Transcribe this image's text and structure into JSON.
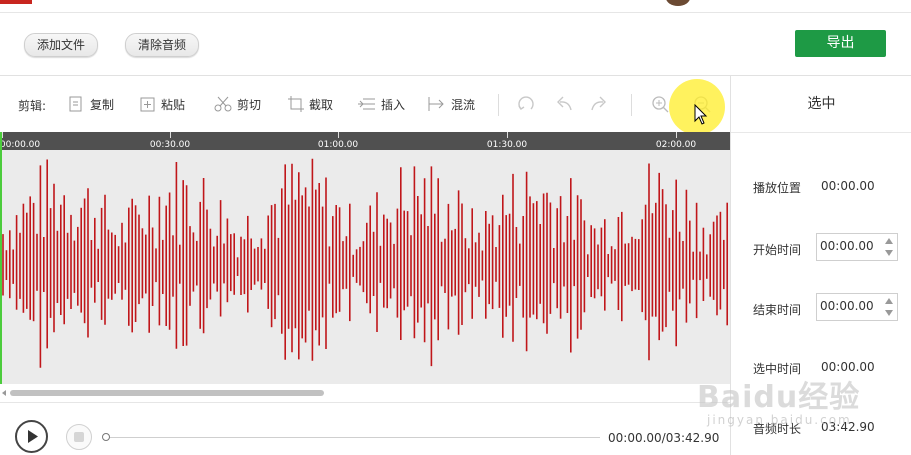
{
  "header": {
    "add_file_label": "添加文件",
    "clear_audio_label": "清除音频",
    "export_label": "导出"
  },
  "toolbar": {
    "edit_label": "剪辑:",
    "copy_label": "复制",
    "paste_label": "粘贴",
    "cut_label": "剪切",
    "trim_label": "截取",
    "insert_label": "插入",
    "mix_label": "混流"
  },
  "timeline": {
    "ticks": [
      "00:00.00",
      "00:30.00",
      "01:00.00",
      "01:30.00",
      "02:00.00"
    ]
  },
  "side_panel": {
    "title": "选中",
    "play_position_label": "播放位置",
    "play_position_value": "00:00.00",
    "start_time_label": "开始时间",
    "start_time_value": "00:00.00",
    "end_time_label": "结束时间",
    "end_time_value": "00:00.00",
    "selected_time_label": "选中时间",
    "selected_time_value": "00:00.00",
    "clip_duration_label": "音频时长",
    "clip_duration_value": "03:42.90"
  },
  "player": {
    "time_readout": "00:00.00/03:42.90",
    "progress": 0.0
  },
  "colors": {
    "waveform": "#c0161a",
    "export_button": "#1e9a45",
    "playhead": "#4ccc3c"
  },
  "watermark": {
    "brand": "Baidu经验",
    "sub": "jingyan.baidu.com"
  }
}
